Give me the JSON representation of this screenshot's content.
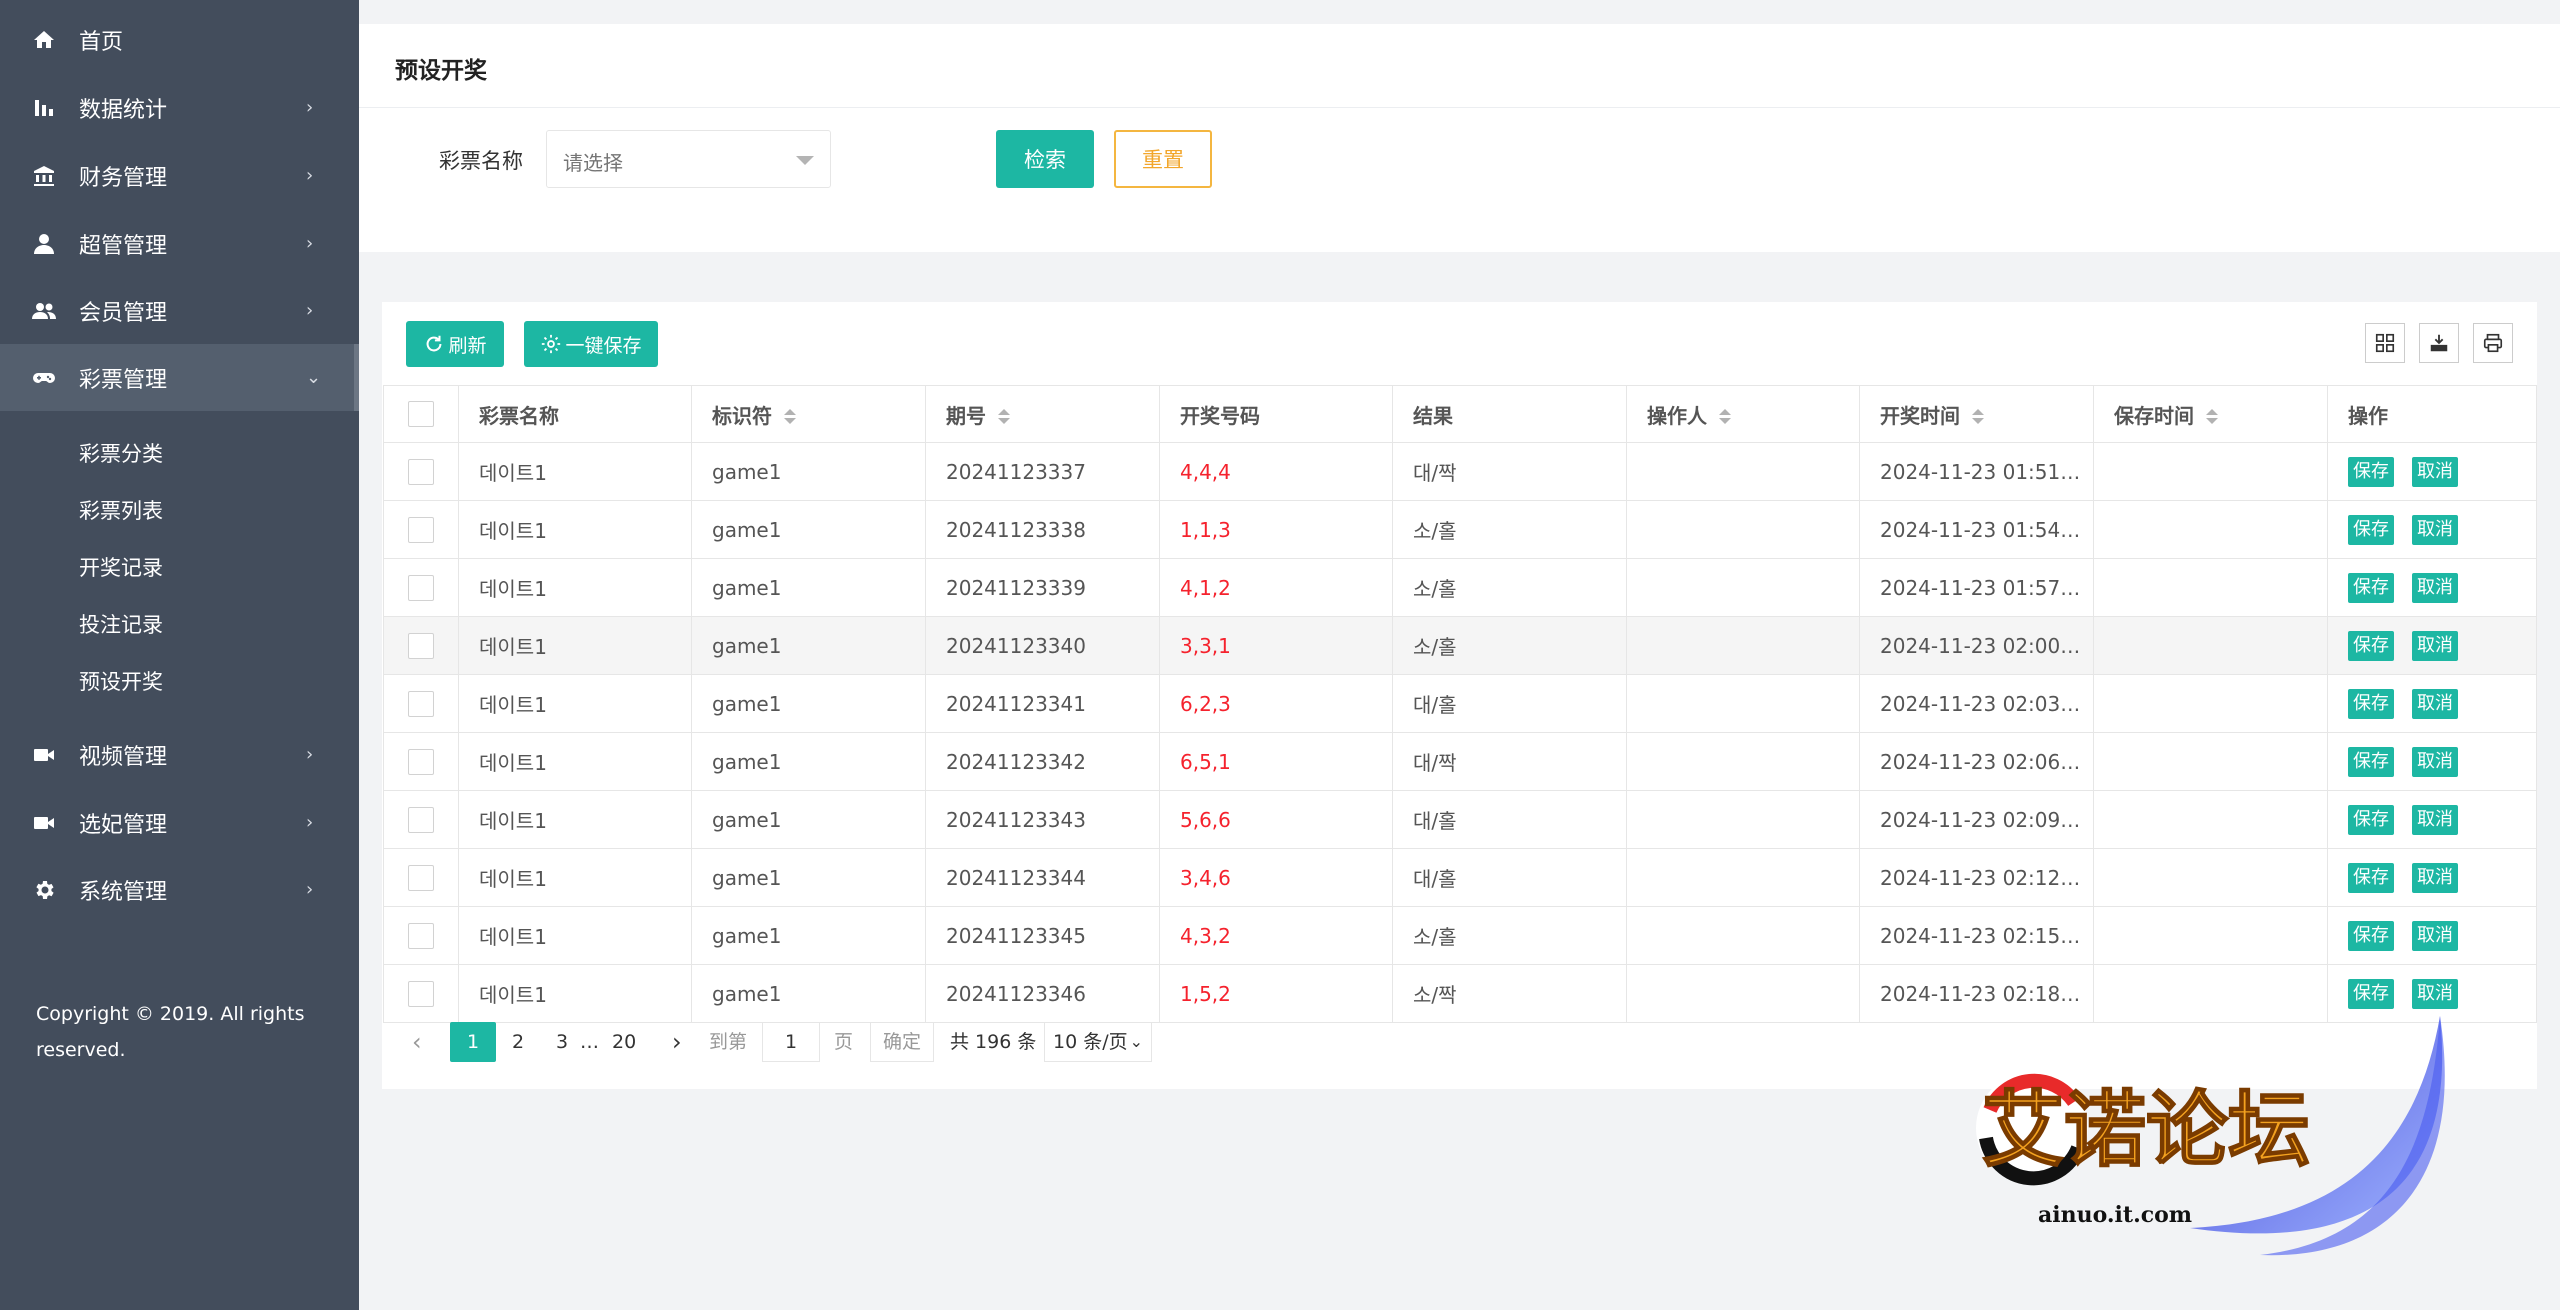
{
  "sidebar": {
    "items": [
      {
        "label": "首页",
        "icon": "home-icon",
        "arrow": ""
      },
      {
        "label": "数据统计",
        "icon": "bar-chart-icon",
        "arrow": "›"
      },
      {
        "label": "财务管理",
        "icon": "bank-icon",
        "arrow": "›"
      },
      {
        "label": "超管管理",
        "icon": "user-icon",
        "arrow": "›"
      },
      {
        "label": "会员管理",
        "icon": "group-icon",
        "arrow": "›"
      },
      {
        "label": "彩票管理",
        "icon": "gamepad-icon",
        "arrow": "⌄"
      },
      {
        "label": "视频管理",
        "icon": "video-icon",
        "arrow": "›"
      },
      {
        "label": "选妃管理",
        "icon": "camera-icon",
        "arrow": "›"
      },
      {
        "label": "系统管理",
        "icon": "gear-icon",
        "arrow": "›"
      }
    ],
    "sub_items": [
      "彩票分类",
      "彩票列表",
      "开奖记录",
      "投注记录",
      "预设开奖"
    ],
    "copyright": "Copyright © 2019. All rights reserved."
  },
  "search": {
    "title": "预设开奖",
    "field_label": "彩票名称",
    "select_placeholder": "请选择",
    "search_button": "检索",
    "reset_button": "重置"
  },
  "toolbar": {
    "refresh_label": "刷新",
    "save_all_label": "一键保存"
  },
  "table": {
    "columns": [
      "彩票名称",
      "标识符",
      "期号",
      "开奖号码",
      "结果",
      "操作人",
      "开奖时间",
      "保存时间",
      "操作"
    ],
    "save_label": "保存",
    "cancel_label": "取消",
    "rows": [
      {
        "name": "데이트1",
        "key": "game1",
        "issue": "20241123337",
        "numbers": "4,4,4",
        "result": "대/짝",
        "operator": "",
        "open_time": "2024-11-23 01:51…",
        "save_time": ""
      },
      {
        "name": "데이트1",
        "key": "game1",
        "issue": "20241123338",
        "numbers": "1,1,3",
        "result": "소/홀",
        "operator": "",
        "open_time": "2024-11-23 01:54…",
        "save_time": ""
      },
      {
        "name": "데이트1",
        "key": "game1",
        "issue": "20241123339",
        "numbers": "4,1,2",
        "result": "소/홀",
        "operator": "",
        "open_time": "2024-11-23 01:57…",
        "save_time": ""
      },
      {
        "name": "데이트1",
        "key": "game1",
        "issue": "20241123340",
        "numbers": "3,3,1",
        "result": "소/홀",
        "operator": "",
        "open_time": "2024-11-23 02:00…",
        "save_time": ""
      },
      {
        "name": "데이트1",
        "key": "game1",
        "issue": "20241123341",
        "numbers": "6,2,3",
        "result": "대/홀",
        "operator": "",
        "open_time": "2024-11-23 02:03…",
        "save_time": ""
      },
      {
        "name": "데이트1",
        "key": "game1",
        "issue": "20241123342",
        "numbers": "6,5,1",
        "result": "대/짝",
        "operator": "",
        "open_time": "2024-11-23 02:06…",
        "save_time": ""
      },
      {
        "name": "데이트1",
        "key": "game1",
        "issue": "20241123343",
        "numbers": "5,6,6",
        "result": "대/홀",
        "operator": "",
        "open_time": "2024-11-23 02:09…",
        "save_time": ""
      },
      {
        "name": "데이트1",
        "key": "game1",
        "issue": "20241123344",
        "numbers": "3,4,6",
        "result": "대/홀",
        "operator": "",
        "open_time": "2024-11-23 02:12…",
        "save_time": ""
      },
      {
        "name": "데이트1",
        "key": "game1",
        "issue": "20241123345",
        "numbers": "4,3,2",
        "result": "소/홀",
        "operator": "",
        "open_time": "2024-11-23 02:15…",
        "save_time": ""
      },
      {
        "name": "데이트1",
        "key": "game1",
        "issue": "20241123346",
        "numbers": "1,5,2",
        "result": "소/짝",
        "operator": "",
        "open_time": "2024-11-23 02:18…",
        "save_time": ""
      }
    ]
  },
  "pager": {
    "current": "1",
    "page2": "2",
    "page3": "3",
    "ellipsis": "…",
    "last": "20",
    "goto_label": "到第",
    "goto_value": "1",
    "page_unit": "页",
    "confirm": "确定",
    "total": "共 196 条",
    "page_size": "10 条/页"
  },
  "watermark": {
    "title": "艾诺论坛",
    "url": "ainuo.it.com"
  },
  "colors": {
    "sidebar_bg": "#434d5c",
    "accent": "#1db7a3",
    "reset_border": "#f4b640",
    "number_red": "#f5222d"
  }
}
